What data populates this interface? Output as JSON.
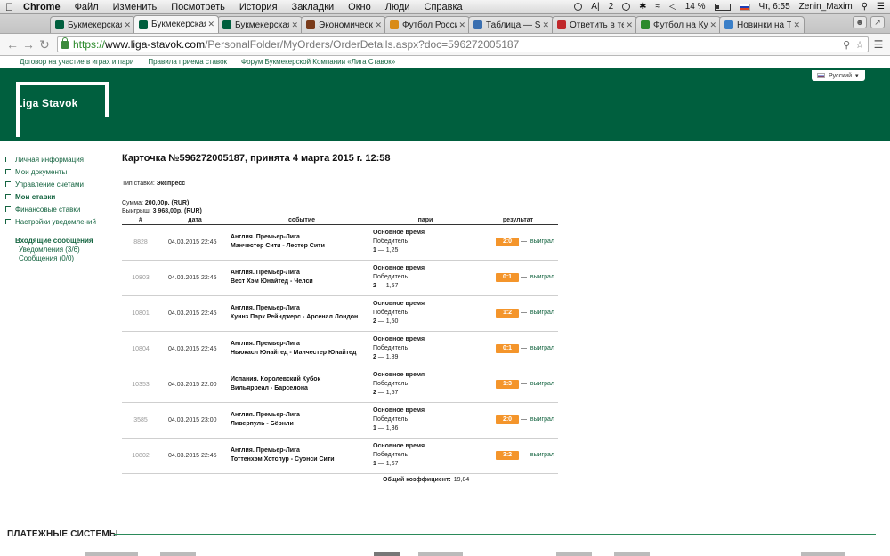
{
  "menubar": {
    "app": "Chrome",
    "items": [
      "Файл",
      "Изменить",
      "Посмотреть",
      "История",
      "Закладки",
      "Окно",
      "Люди",
      "Справка"
    ],
    "status_ai": "A|",
    "status_num": "2",
    "battery": "14 %",
    "clock": "Чт, 6:55",
    "user": "Zenin_Maxim"
  },
  "tabs": [
    {
      "label": "Букмекерская к",
      "color": "#005f3e",
      "active": false
    },
    {
      "label": "Букмекерская к",
      "color": "#005f3e",
      "active": true
    },
    {
      "label": "Букмекерская к",
      "color": "#005f3e",
      "active": false
    },
    {
      "label": "Экономически",
      "color": "#7a3b1a",
      "active": false
    },
    {
      "label": "Футбол России",
      "color": "#d98b16",
      "active": false
    },
    {
      "label": "Таблица — Spr",
      "color": "#3a6fb0",
      "active": false
    },
    {
      "label": "Ответить в тем",
      "color": "#c0282b",
      "active": false
    },
    {
      "label": "Футбол на Кули",
      "color": "#2a8a2a",
      "active": false
    },
    {
      "label": "Новинки на TF",
      "color": "#3a7fc8",
      "active": false
    }
  ],
  "address": {
    "scheme": "https://",
    "host": "www.liga-stavok.com",
    "path": "/PersonalFolder/MyOrders/OrderDetails.aspx?doc=596272005187"
  },
  "site": {
    "toplinks": [
      "Договор на участие в играх и пари",
      "Правила приема ставок",
      "Форум Букмекерской Компании «Лига Ставок»"
    ],
    "logo": "Liga Stavok",
    "language": "Русский"
  },
  "sidebar": {
    "items": [
      {
        "label": "Личная информация",
        "bold": false
      },
      {
        "label": "Мои документы",
        "bold": false
      },
      {
        "label": "Управление счетами",
        "bold": false
      },
      {
        "label": "Мои ставки",
        "bold": true
      },
      {
        "label": "Финансовые ставки",
        "bold": false
      },
      {
        "label": "Настройки уведомлений",
        "bold": false
      }
    ],
    "inbox_title": "Входящие сообщения",
    "inbox_items": [
      "Уведомления (3/6)",
      "Сообщения (0/0)"
    ]
  },
  "order": {
    "title": "Карточка №596272005187, принята 4 марта 2015 г. 12:58",
    "bet_type_label": "Тип ставки:",
    "bet_type": "Экспресс",
    "sum_label": "Сумма:",
    "sum": "200,00р. (RUR)",
    "win_label": "Выигрыш:",
    "win": "3 968,00р. (RUR)",
    "columns": [
      "#",
      "дата",
      "событие",
      "пари",
      "результат"
    ],
    "rows": [
      {
        "num": "8828",
        "date": "04.03.2015 22:45",
        "league": "Англия. Премьер-Лига",
        "match": "Манчестер Сити - Лестер Сити",
        "period": "Основное время",
        "market": "Победитель",
        "pick": "1",
        "odds": "1,25",
        "score": "2:0",
        "result": "выиграл"
      },
      {
        "num": "10803",
        "date": "04.03.2015 22:45",
        "league": "Англия. Премьер-Лига",
        "match": "Вест Хэм Юнайтед - Челси",
        "period": "Основное время",
        "market": "Победитель",
        "pick": "2",
        "odds": "1,57",
        "score": "0:1",
        "result": "выиграл"
      },
      {
        "num": "10801",
        "date": "04.03.2015 22:45",
        "league": "Англия. Премьер-Лига",
        "match": "Куинз Парк Рейнджерс - Арсенал Лондон",
        "period": "Основное время",
        "market": "Победитель",
        "pick": "2",
        "odds": "1,50",
        "score": "1:2",
        "result": "выиграл"
      },
      {
        "num": "10804",
        "date": "04.03.2015 22:45",
        "league": "Англия. Премьер-Лига",
        "match": "Ньюкасл Юнайтед - Манчестер Юнайтед",
        "period": "Основное время",
        "market": "Победитель",
        "pick": "2",
        "odds": "1,89",
        "score": "0:1",
        "result": "выиграл"
      },
      {
        "num": "10353",
        "date": "04.03.2015 22:00",
        "league": "Испания. Королевский Кубок",
        "match": "Вильярреал - Барселона",
        "period": "Основное время",
        "market": "Победитель",
        "pick": "2",
        "odds": "1,57",
        "score": "1:3",
        "result": "выиграл"
      },
      {
        "num": "3585",
        "date": "04.03.2015 23:00",
        "league": "Англия. Премьер-Лига",
        "match": "Ливерпуль - Бёрнли",
        "period": "Основное время",
        "market": "Победитель",
        "pick": "1",
        "odds": "1,36",
        "score": "2:0",
        "result": "выиграл"
      },
      {
        "num": "10802",
        "date": "04.03.2015 22:45",
        "league": "Англия. Премьер-Лига",
        "match": "Тоттенхэм Хотспур - Суонси Сити",
        "period": "Основное время",
        "market": "Победитель",
        "pick": "1",
        "odds": "1,67",
        "score": "3:2",
        "result": "выиграл"
      }
    ],
    "total_label": "Общий коэффициент:",
    "total_value": "19,84"
  },
  "footer": {
    "payments_title": "ПЛАТЕЖНЫЕ СИСТЕМЫ"
  },
  "colors": {
    "brand": "#005f3e",
    "link": "#146440",
    "score": "#f4952b"
  }
}
